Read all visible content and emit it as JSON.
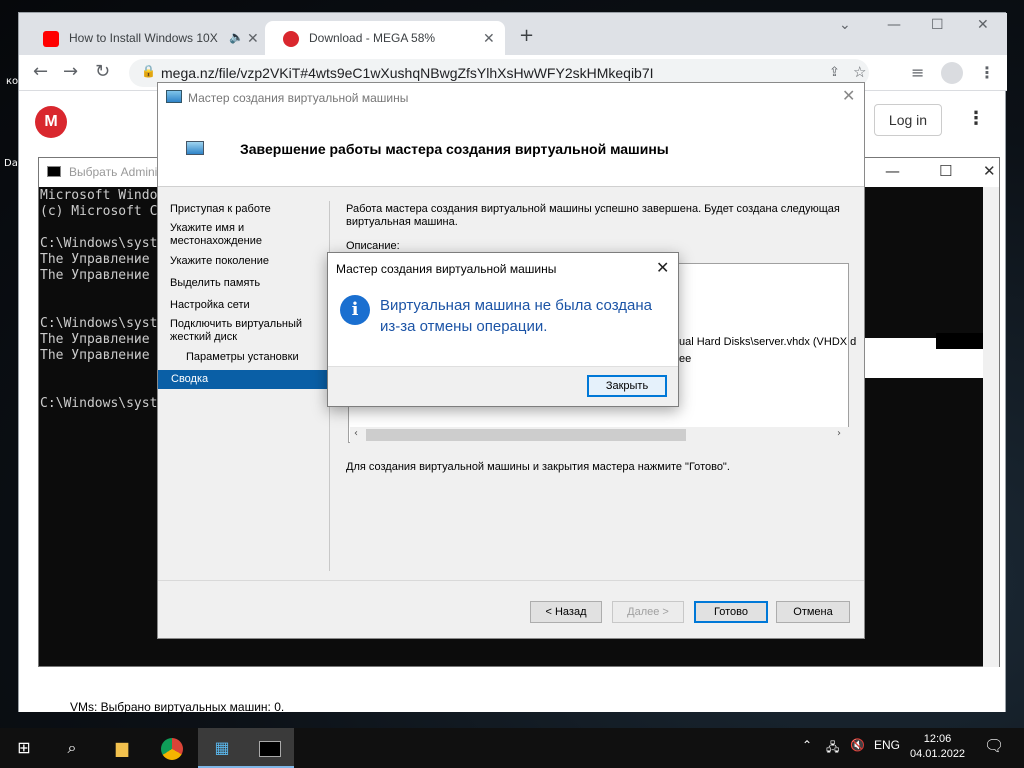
{
  "desktop": {
    "label1": "ко",
    "label2": "Da"
  },
  "browser": {
    "tabs": [
      {
        "title": "How to Install Windows 10X",
        "favicon": "youtube-icon",
        "color": "#ff0000"
      },
      {
        "title": "Download - MEGA 58%",
        "favicon": "mega-icon",
        "color": "#d9272e"
      }
    ],
    "new_tab": "+",
    "url": "mega.nz/file/vzp2VKiT#4wts9eC1wXushqNBwgZfsYlhXsHwWFY2skHMkeqib7I",
    "login_label": "Log in",
    "logo_text": "M"
  },
  "cmd": {
    "title": "Выбрать Admini",
    "lines": [
      "Microsoft Windo",
      "(c) Microsoft C",
      "",
      "C:\\Windows\\syst",
      "The Управление",
      "The Управление",
      "",
      "",
      "C:\\Windows\\syst",
      "The Управление",
      "The Управление",
      "",
      "",
      "C:\\Windows\\syst"
    ]
  },
  "wizard": {
    "title": "Мастер создания виртуальной машины",
    "header": "Завершение работы мастера создания виртуальной машины",
    "steps": [
      "Приступая к работе",
      "Укажите имя и местонахождение",
      "Укажите поколение",
      "Выделить память",
      "Настройка сети",
      "Подключить виртуальный жесткий диск",
      "Параметры установки",
      "Сводка"
    ],
    "intro": "Работа мастера создания виртуальной машины успешно завершена. Будет создана следующая виртуальная машина.",
    "desc_label": "Описание:",
    "desc_lines": [
      "ual Hard Disks\\server.vhdx (VHDX d",
      "ee"
    ],
    "finish_note": "Для создания виртуальной машины и закрытия мастера нажмите \"Готово\".",
    "buttons": {
      "back": "< Назад",
      "next": "Далее >",
      "finish": "Готово",
      "cancel": "Отмена"
    }
  },
  "msgbox": {
    "title": "Мастер создания виртуальной машины",
    "message": "Виртуальная машина не была создана из-за отмены операции.",
    "close_label": "Закрыть"
  },
  "status_line": "VMs: Выбрано виртуальных машин: 0.",
  "taskbar": {
    "lang": "ENG",
    "time": "12:06",
    "date": "04.01.2022"
  }
}
